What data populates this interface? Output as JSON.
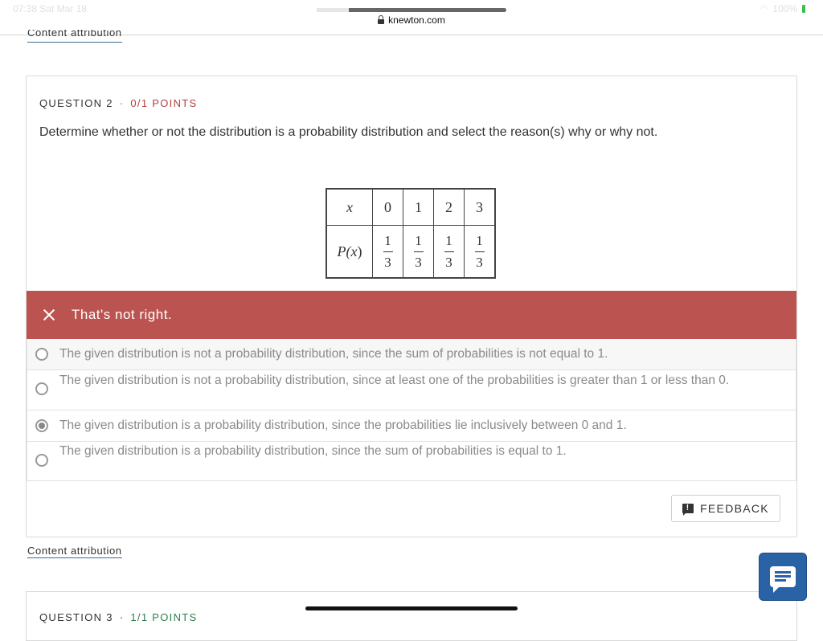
{
  "status_bar": {
    "time": "07:38  Sat Mar 18",
    "battery": "100%"
  },
  "browser": {
    "url": "knewton.com"
  },
  "content_attribution": "Content attribution",
  "question2": {
    "label": "QUESTION 2",
    "separator": "·",
    "points": "0/1 POINTS",
    "prompt": "Determine whether or not the distribution is a probability distribution and select the reason(s) why or why not."
  },
  "table": {
    "x_label": "x",
    "p_label_prefix": "P(",
    "p_label_var": "x",
    "p_label_suffix": ")",
    "x_values": [
      "0",
      "1",
      "2",
      "3"
    ],
    "p_numerators": [
      "1",
      "1",
      "1",
      "1"
    ],
    "p_denominators": [
      "3",
      "3",
      "3",
      "3"
    ]
  },
  "banner": {
    "text": "That's not right."
  },
  "options": [
    {
      "text": "The given distribution is not a probability distribution, since the sum of probabilities is not equal to 1.",
      "selected": false
    },
    {
      "text": "The given distribution is not a probability distribution, since at least one of the probabilities is greater than 1 or less than 0.",
      "selected": false
    },
    {
      "text": "The given distribution is a probability distribution, since the probabilities lie inclusively between 0 and 1.",
      "selected": true
    },
    {
      "text": "The given distribution is a probability distribution, since the sum of probabilities is equal to 1.",
      "selected": false
    }
  ],
  "feedback": {
    "label": "FEEDBACK",
    "icon": "!"
  },
  "question3": {
    "label": "QUESTION 3",
    "separator": "·",
    "points": "1/1 POINTS"
  }
}
